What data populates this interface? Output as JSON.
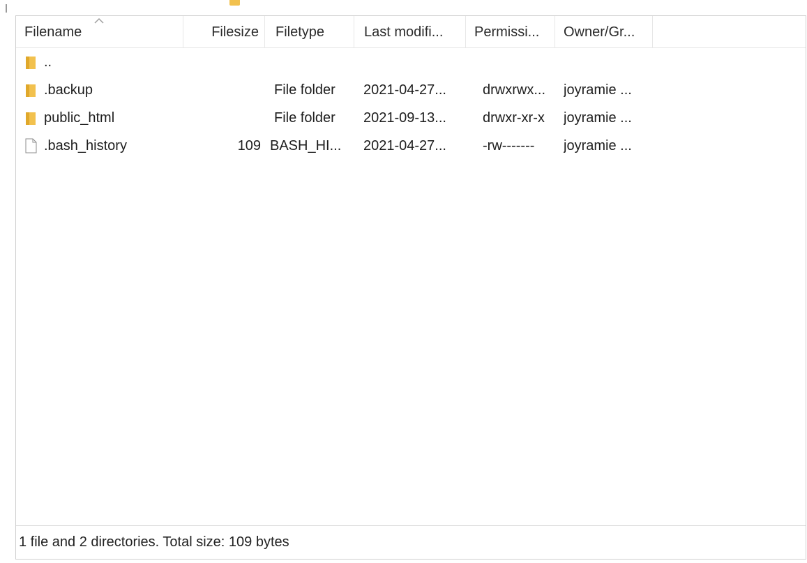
{
  "columns": {
    "filename": "Filename",
    "filesize": "Filesize",
    "filetype": "Filetype",
    "last_modified": "Last modifi...",
    "permissions": "Permissi...",
    "owner_group": "Owner/Gr..."
  },
  "rows": [
    {
      "icon": "folder-icon",
      "name": "..",
      "size": "",
      "type": "",
      "modified": "",
      "perms": "",
      "owner": ""
    },
    {
      "icon": "folder-icon",
      "name": ".backup",
      "size": "",
      "type": "File folder",
      "modified": "2021-04-27...",
      "perms": "drwxrwx...",
      "owner": "joyramie ..."
    },
    {
      "icon": "folder-icon",
      "name": "public_html",
      "size": "",
      "type": "File folder",
      "modified": "2021-09-13...",
      "perms": "drwxr-xr-x",
      "owner": "joyramie ..."
    },
    {
      "icon": "file-icon",
      "name": ".bash_history",
      "size": "109",
      "type": "BASH_HI...",
      "modified": "2021-04-27...",
      "perms": "-rw-------",
      "owner": "joyramie ..."
    }
  ],
  "status": {
    "text": "1 file and 2 directories. Total size: 109 bytes"
  },
  "colors": {
    "folder": "#f2c14e",
    "folder_dark": "#e0a82b",
    "border": "#cfcfcf"
  }
}
